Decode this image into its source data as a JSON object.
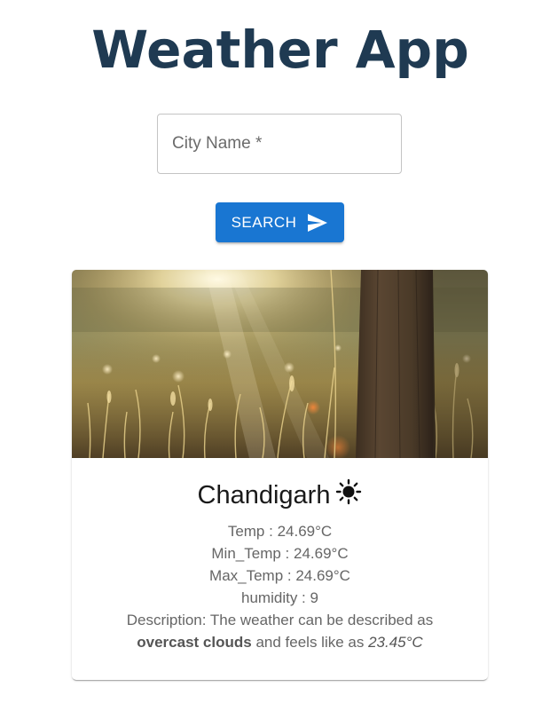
{
  "app": {
    "title": "Weather App"
  },
  "search": {
    "placeholder": "City Name *",
    "value": "",
    "button_label": "SEARCH",
    "button_icon": "send-icon"
  },
  "weather_card": {
    "image": "sunlit-meadow-with-tree-trunk",
    "city": "Chandigarh",
    "condition_icon": "sun-icon",
    "temp_label": "Temp",
    "temp_value": "24.69°C",
    "min_temp_label": "Min_Temp",
    "min_temp_value": "24.69°C",
    "max_temp_label": "Max_Temp",
    "max_temp_value": "24.69°C",
    "humidity_label": "humidity",
    "humidity_value": "9",
    "description_prefix": "Description: The weather can be described as",
    "description_condition": "overcast clouds",
    "description_middle": "and feels like as",
    "feels_like": "23.45°C"
  },
  "colors": {
    "title": "#1f3a52",
    "primary": "#1976d2",
    "text_muted": "#666666"
  }
}
